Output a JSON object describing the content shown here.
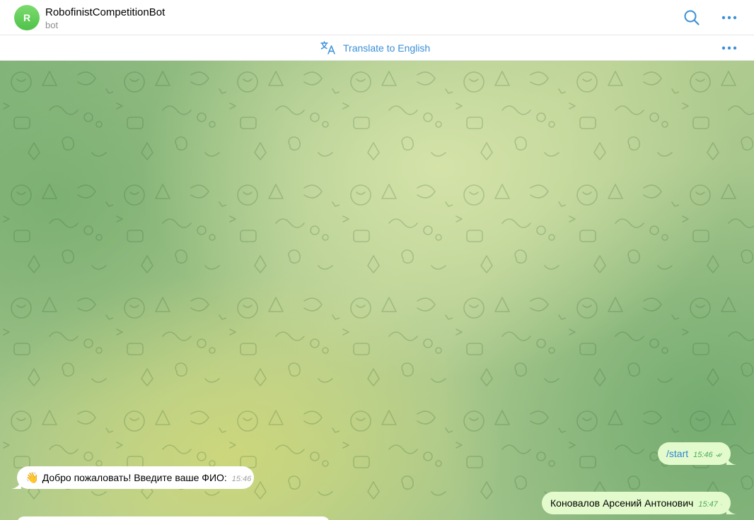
{
  "header": {
    "avatar_letter": "R",
    "title": "RobofinistCompetitionBot",
    "subtitle": "bot"
  },
  "translate_bar": {
    "label": "Translate to English"
  },
  "messages": [
    {
      "direction": "out",
      "text": "/start",
      "time": "15:46"
    },
    {
      "direction": "in",
      "emoji": "👋",
      "text": "Добро пожаловать! Введите ваше ФИО:",
      "time": "15:46"
    },
    {
      "direction": "out",
      "text": "Коновалов Арсений Антонович",
      "time": "15:47"
    }
  ],
  "colors": {
    "accent": "#3a8fd6",
    "outgoing_bubble": "#e3fbcc",
    "incoming_bubble": "#ffffff",
    "avatar": "#5ecb55"
  },
  "icons": {
    "search": "search-icon",
    "more": "more-horizontal-icon",
    "translate": "translate-icon",
    "read": "double-check-icon"
  }
}
